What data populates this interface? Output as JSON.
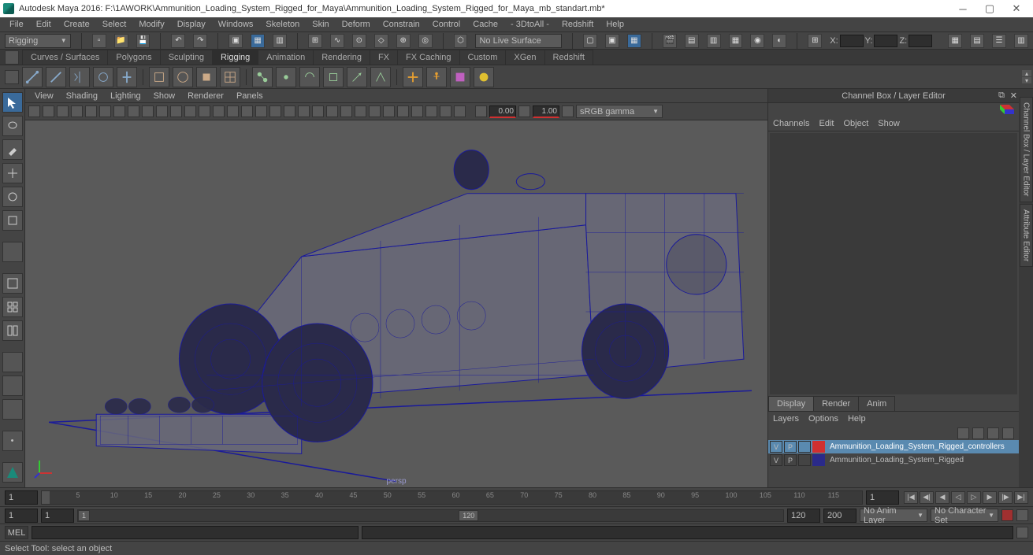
{
  "app_title": "Autodesk Maya 2016: F:\\1AWORK\\Ammunition_Loading_System_Rigged_for_Maya\\Ammunition_Loading_System_Rigged_for_Maya_mb_standart.mb*",
  "menubar": [
    "File",
    "Edit",
    "Create",
    "Select",
    "Modify",
    "Display",
    "Windows",
    "Skeleton",
    "Skin",
    "Deform",
    "Constrain",
    "Control",
    "Cache",
    "- 3DtoAll -",
    "Redshift",
    "Help"
  ],
  "workspace_combo": "Rigging",
  "live_surface": "No Live Surface",
  "xyz": {
    "x": "X:",
    "y": "Y:",
    "z": "Z:"
  },
  "shelf_tabs": [
    "Curves / Surfaces",
    "Polygons",
    "Sculpting",
    "Rigging",
    "Animation",
    "Rendering",
    "FX",
    "FX Caching",
    "Custom",
    "XGen",
    "Redshift"
  ],
  "shelf_active": "Rigging",
  "panel_menu": [
    "View",
    "Shading",
    "Lighting",
    "Show",
    "Renderer",
    "Panels"
  ],
  "panel_fields": {
    "a": "0.00",
    "b": "1.00"
  },
  "gamma": "sRGB gamma",
  "persp_label": "persp",
  "channelbox": {
    "title": "Channel Box / Layer Editor",
    "menu": [
      "Channels",
      "Edit",
      "Object",
      "Show"
    ],
    "tabs": [
      "Display",
      "Render",
      "Anim"
    ],
    "layer_menu": [
      "Layers",
      "Options",
      "Help"
    ],
    "layers": [
      {
        "v": "V",
        "p": "P",
        "color": "#d03030",
        "name": "Ammunition_Loading_System_Rigged_controllers",
        "sel": true,
        "namebg": "#5a8ab0"
      },
      {
        "v": "V",
        "p": "P",
        "color": "#2a2a8a",
        "name": "Ammunition_Loading_System_Rigged",
        "sel": false
      }
    ]
  },
  "side_tabs": [
    "Channel Box / Layer Editor",
    "Attribute Editor"
  ],
  "time": {
    "start": "1",
    "end": "120",
    "cur": "1",
    "ticks": [
      "5",
      "10",
      "15",
      "20",
      "25",
      "30",
      "35",
      "40",
      "45",
      "50",
      "55",
      "60",
      "65",
      "70",
      "75",
      "80",
      "85",
      "90",
      "95",
      "100",
      "105",
      "110",
      "115"
    ]
  },
  "range": {
    "a": "1",
    "b": "1",
    "c": "120",
    "d": "200"
  },
  "anim_layer": "No Anim Layer",
  "char_set": "No Character Set",
  "cmd_label": "MEL",
  "help": "Select Tool: select an object"
}
